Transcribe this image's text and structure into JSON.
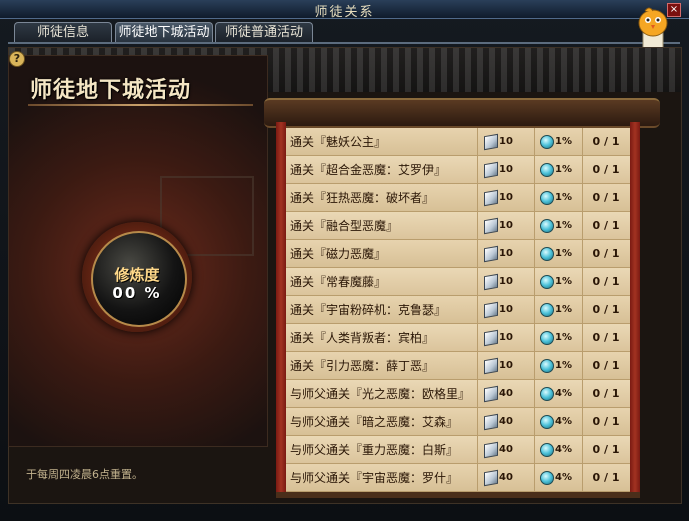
{
  "window": {
    "title": "师徒关系",
    "close_label": "×"
  },
  "tabs": [
    {
      "label": "师徒信息"
    },
    {
      "label": "师徒地下城活动"
    },
    {
      "label": "师徒普通活动"
    }
  ],
  "help": {
    "label": "?"
  },
  "panel": {
    "title": "师徒地下城活动",
    "progress_label": "修炼度",
    "progress_value": "00 %",
    "reset_note": "于每周四凌晨6点重置。"
  },
  "activities": [
    {
      "name": "通关『魅妖公主』",
      "reward_a": "10",
      "reward_b": "1%",
      "progress": "0 / 1"
    },
    {
      "name": "通关『超合金恶魔：艾罗伊』",
      "reward_a": "10",
      "reward_b": "1%",
      "progress": "0 / 1"
    },
    {
      "name": "通关『狂热恶魔：破坏者』",
      "reward_a": "10",
      "reward_b": "1%",
      "progress": "0 / 1"
    },
    {
      "name": "通关『融合型恶魔』",
      "reward_a": "10",
      "reward_b": "1%",
      "progress": "0 / 1"
    },
    {
      "name": "通关『磁力恶魔』",
      "reward_a": "10",
      "reward_b": "1%",
      "progress": "0 / 1"
    },
    {
      "name": "通关『常春魔藤』",
      "reward_a": "10",
      "reward_b": "1%",
      "progress": "0 / 1"
    },
    {
      "name": "通关『宇宙粉碎机：克鲁瑟』",
      "reward_a": "10",
      "reward_b": "1%",
      "progress": "0 / 1"
    },
    {
      "name": "通关『人类背叛者：宾柏』",
      "reward_a": "10",
      "reward_b": "1%",
      "progress": "0 / 1"
    },
    {
      "name": "通关『引力恶魔：薛丁恶』",
      "reward_a": "10",
      "reward_b": "1%",
      "progress": "0 / 1"
    },
    {
      "name": "与师父通关『光之恶魔：欧格里』",
      "reward_a": "40",
      "reward_b": "4%",
      "progress": "0 / 1"
    },
    {
      "name": "与师父通关『暗之恶魔：艾森』",
      "reward_a": "40",
      "reward_b": "4%",
      "progress": "0 / 1"
    },
    {
      "name": "与师父通关『重力恶魔：白斯』",
      "reward_a": "40",
      "reward_b": "4%",
      "progress": "0 / 1"
    },
    {
      "name": "与师父通关『宇宙恶魔：罗什』",
      "reward_a": "40",
      "reward_b": "4%",
      "progress": "0 / 1"
    }
  ],
  "colors": {
    "accent_gold": "#f4e6c4",
    "scroll_red": "#a23322",
    "parchment": "#e7d3ae"
  },
  "icons": {
    "reward_a": "crystal-cube-icon",
    "reward_b": "spirit-orb-icon",
    "mascot": "chick-mascot-icon"
  }
}
